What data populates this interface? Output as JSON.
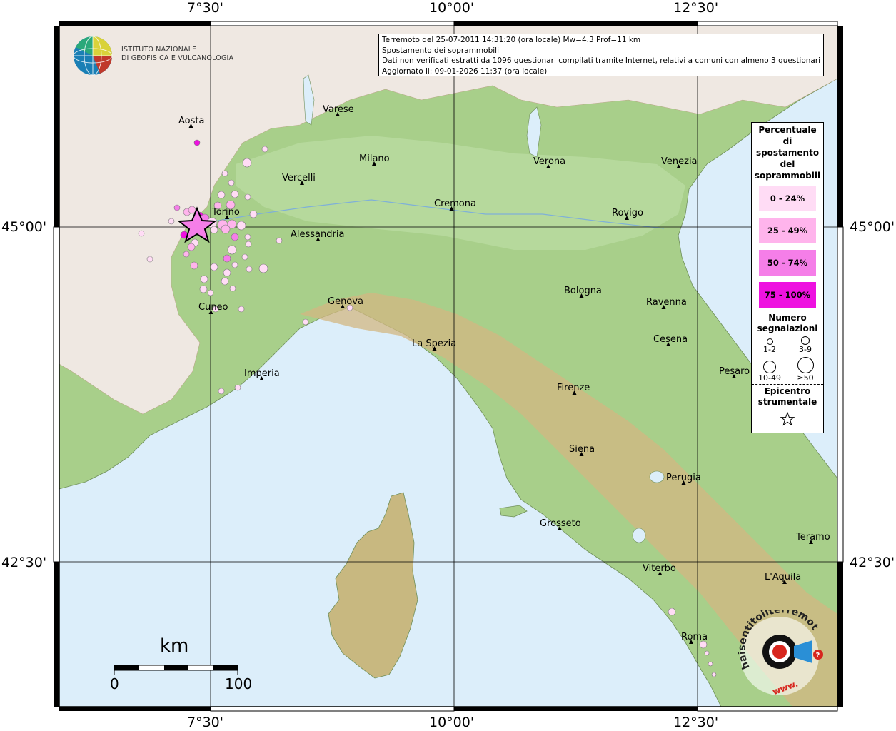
{
  "info": {
    "line1": "Terremoto del 25-07-2011 14:31:20 (ora locale) Mw=4.3 Prof=11 km",
    "line2": "Spostamento dei soprammobili",
    "line3": "Dati non verificati estratti da 1096 questionari compilati tramite Internet, relativi a comuni con almeno 3 questionari.",
    "line4": "Aggiornato il: 09-01-2026 11:37 (ora locale)"
  },
  "logo": {
    "line1": "ISTITUTO NAZIONALE",
    "line2": "DI GEOFISICA E VULCANOLOGIA"
  },
  "grid_labels": {
    "top": [
      "7°30'",
      "10°00'",
      "12°30'"
    ],
    "bottom": [
      "7°30'",
      "10°00'",
      "12°30'"
    ],
    "left": [
      "45°00'",
      "42°30'"
    ],
    "right": [
      "45°00'",
      "42°30'"
    ]
  },
  "legend": {
    "title_lines": [
      "Percentuale",
      "di",
      "spostamento",
      "del",
      "soprammobili"
    ],
    "classes": [
      {
        "label": "0 - 24%",
        "color": "#ffdcf5"
      },
      {
        "label": "25 - 49%",
        "color": "#ffb4ec"
      },
      {
        "label": "50 - 74%",
        "color": "#f57ee8"
      },
      {
        "label": "75 - 100%",
        "color": "#ee11e0"
      }
    ],
    "count_title_lines": [
      "Numero",
      "segnalazioni"
    ],
    "sizes": [
      "1-2",
      "3-9",
      "10-49",
      "≥50"
    ],
    "epicenter_title_lines": [
      "Epicentro",
      "strumentale"
    ]
  },
  "cities": [
    {
      "name": "Aosta"
    },
    {
      "name": "Varese"
    },
    {
      "name": "Milano"
    },
    {
      "name": "Verona"
    },
    {
      "name": "Venezia"
    },
    {
      "name": "Vercelli"
    },
    {
      "name": "Cremona"
    },
    {
      "name": "Rovigo"
    },
    {
      "name": "Torino"
    },
    {
      "name": "Alessandria"
    },
    {
      "name": "Bologna"
    },
    {
      "name": "Ravenna"
    },
    {
      "name": "Cuneo"
    },
    {
      "name": "Genova"
    },
    {
      "name": "Cesena"
    },
    {
      "name": "La Spezia"
    },
    {
      "name": "Imperia"
    },
    {
      "name": "Pesaro"
    },
    {
      "name": "Firenze"
    },
    {
      "name": "Siena"
    },
    {
      "name": "Perugia"
    },
    {
      "name": "Grosseto"
    },
    {
      "name": "Teramo"
    },
    {
      "name": "L'Aquila"
    },
    {
      "name": "Viterbo"
    },
    {
      "name": "Roma"
    }
  ],
  "scale_bar": {
    "title": "km",
    "min_label": "0",
    "max_label": "100"
  },
  "watermark": {
    "text": "haisentitoilterremoto.it",
    "url_text": "www."
  },
  "colors": {
    "sea": "#dceefa",
    "plain": "#a9d08e",
    "hills": "#d4b87a",
    "mountains": "#f5f0ea"
  }
}
